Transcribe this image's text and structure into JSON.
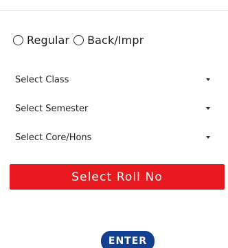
{
  "exam_type": {
    "options": [
      {
        "label": "Regular",
        "selected": false
      },
      {
        "label": "Back/Impr",
        "selected": false
      }
    ]
  },
  "selects": {
    "class_placeholder": "Select Class",
    "semester_placeholder": "Select Semester",
    "core_hons_placeholder": "Select Core/Hons"
  },
  "buttons": {
    "select_roll_label": "Select Roll No",
    "enter_label": "ENTER"
  },
  "colors": {
    "roll_button_bg": "#e8191e",
    "enter_button_bg": "#123f8f"
  },
  "icons": {
    "dropdown": "caret-down-icon",
    "radio": "radio-unchecked-icon"
  }
}
